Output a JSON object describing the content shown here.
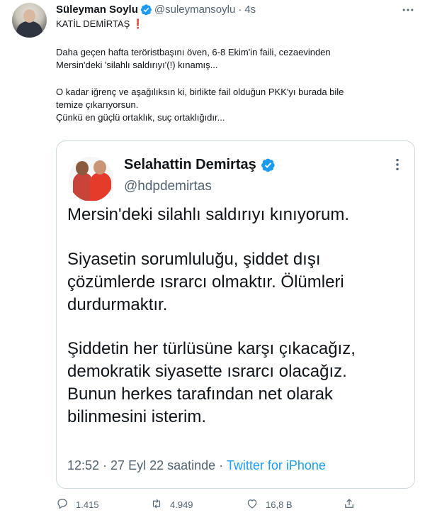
{
  "tweet": {
    "author_name": "Süleyman Soylu",
    "handle": "@suleymansoylu",
    "separator": "·",
    "time": "4s",
    "lines": [
      "KATİL DEMİRTAŞ",
      "Daha geçen hafta teröristbaşını öven, 6-8 Ekim'in faili, cezaevinden",
      "Mersin'deki 'silahlı saldırıyı'(!) kınamış...",
      "O kadar iğrenç ve aşağılıksın ki, birlikte fail olduğun PKK'yı burada bile",
      "temize çıkarıyorsun.",
      "Çünkü en güçlü ortaklık, suç ortaklığıdır..."
    ],
    "emoji": "❗"
  },
  "quote": {
    "author_name": "Selahattin Demirtaş",
    "handle": "@hdpdemirtas",
    "lines": [
      "Mersin'deki silahlı saldırıyı kınıyorum.",
      "Siyasetin sorumluluğu, şiddet dışı",
      "çözümlerde ısrarcı olmaktır. Ölümleri",
      "durdurmaktır.",
      "Şiddetin her türlüsüne karşı çıkacağız,",
      "demokratik siyasette ısrarcı olacağız.",
      "Bunun herkes tarafından net olarak",
      "bilinmesini isterim."
    ],
    "timestamp": "12:52 · 27 Eyl 22 saatinde",
    "meta_separator": "·",
    "source": "Twitter for iPhone"
  },
  "actions": {
    "replies": "1.415",
    "retweets": "4.949",
    "likes": "16,8 B"
  },
  "icons": {
    "verified": "verified-badge-icon",
    "more": "more-icon",
    "reply": "reply-icon",
    "retweet": "retweet-icon",
    "like": "heart-icon",
    "share": "share-icon"
  },
  "colors": {
    "accent": "#1d9bf0",
    "text": "#0f1419",
    "secondary": "#536471",
    "border": "#cfd9de",
    "alert": "#d0021b"
  }
}
